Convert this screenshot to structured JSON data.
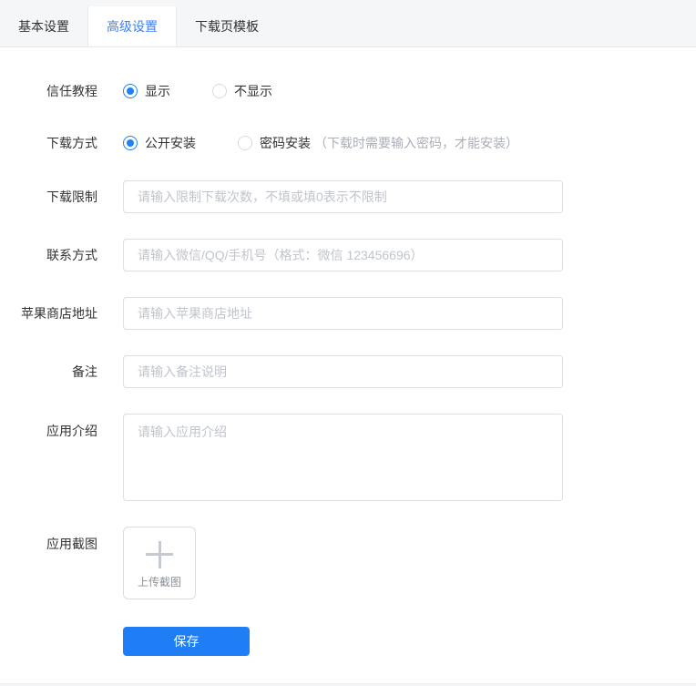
{
  "tabs": {
    "items": [
      {
        "label": "基本设置",
        "active": false
      },
      {
        "label": "高级设置",
        "active": true
      },
      {
        "label": "下载页模板",
        "active": false
      }
    ]
  },
  "form": {
    "trust_tutorial": {
      "label": "信任教程",
      "options": [
        {
          "label": "显示",
          "selected": true
        },
        {
          "label": "不显示",
          "selected": false
        }
      ]
    },
    "download_method": {
      "label": "下载方式",
      "options": [
        {
          "label": "公开安装",
          "selected": true
        },
        {
          "label": "密码安装",
          "selected": false
        }
      ],
      "hint": "（下载时需要输入密码，才能安装）"
    },
    "download_limit": {
      "label": "下载限制",
      "placeholder": "请输入限制下载次数，不填或填0表示不限制",
      "value": ""
    },
    "contact": {
      "label": "联系方式",
      "placeholder": "请输入微信/QQ/手机号（格式：微信 123456696）",
      "value": ""
    },
    "app_store_url": {
      "label": "苹果商店地址",
      "placeholder": "请输入苹果商店地址",
      "value": ""
    },
    "remark": {
      "label": "备注",
      "placeholder": "请输入备注说明",
      "value": ""
    },
    "app_intro": {
      "label": "应用介绍",
      "placeholder": "请输入应用介绍",
      "value": ""
    },
    "app_screenshot": {
      "label": "应用截图",
      "upload_text": "上传截图"
    },
    "save_label": "保存"
  },
  "colors": {
    "accent_blue": "#1f7df6",
    "radio_blue": "#2080f6",
    "tab_active_text": "#3d7ff5",
    "header_background": "#f5f6f8",
    "input_border": "#dcdfe6",
    "placeholder_text": "#c0c4cc"
  }
}
